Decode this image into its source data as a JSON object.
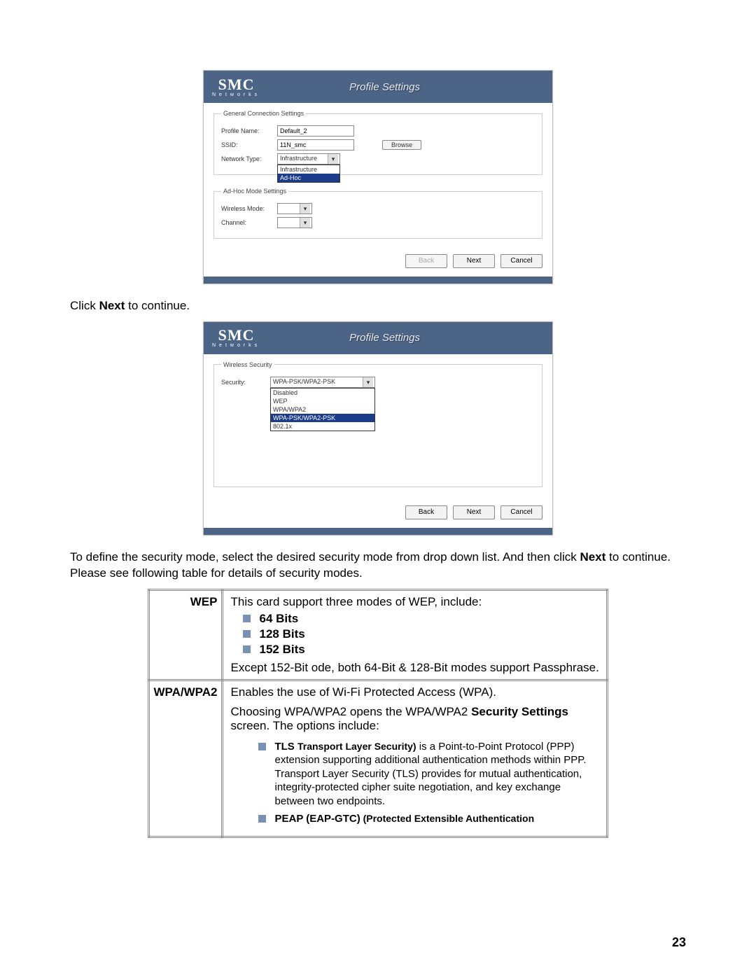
{
  "logo": {
    "main": "SMC",
    "sub": "Networks"
  },
  "dialog_title": "Profile Settings",
  "dialog1": {
    "legend_general": "General Connection Settings",
    "profile_label": "Profile Name:",
    "profile_value": "Default_2",
    "ssid_label": "SSID:",
    "ssid_value": "11N_smc",
    "browse": "Browse",
    "nettype_label": "Network Type:",
    "nettype_value": "Infrastructure",
    "nettype_options": [
      "Infrastructure",
      "Ad-Hoc"
    ],
    "legend_adhoc": "Ad-Hoc Mode Settings",
    "wmode_label": "Wireless Mode:",
    "channel_label": "Channel:",
    "buttons": {
      "back": "Back",
      "next": "Next",
      "cancel": "Cancel"
    }
  },
  "instruction1_pre": "Click ",
  "instruction1_bold": "Next",
  "instruction1_post": " to continue.",
  "dialog2": {
    "legend_sec": "Wireless Security",
    "sec_label": "Security:",
    "sec_value": "WPA-PSK/WPA2-PSK",
    "sec_options": [
      "Disabled",
      "WEP",
      "WPA/WPA2",
      "WPA-PSK/WPA2-PSK",
      "802.1x"
    ],
    "buttons": {
      "back": "Back",
      "next": "Next",
      "cancel": "Cancel"
    }
  },
  "instruction2_a": "To define the security mode, select the desired security mode from drop down list. And then click ",
  "instruction2_bold": "Next",
  "instruction2_b": " to continue. Please see following table for details of security modes.",
  "table": {
    "wep_head": "WEP",
    "wep_intro": "This card support three modes of WEP, include:",
    "wep_bits": [
      "64 Bits",
      "128 Bits",
      "152 Bits"
    ],
    "wep_note": "Except 152-Bit ode, both 64-Bit & 128-Bit modes support Passphrase.",
    "wpa_head": "WPA/WPA2",
    "wpa_l1": "Enables the use of Wi-Fi Protected Access (WPA).",
    "wpa_l2a": "Choosing WPA/WPA2 opens the WPA/WPA2 ",
    "wpa_l2b": "Security Settings",
    "wpa_l2c": " screen. The options include:",
    "tls_head": "TLS ",
    "tls_sub": "Transport Layer Security)",
    "tls_body": " is a Point-to-Point Protocol (PPP) extension supporting additional authentication methods within PPP. Transport Layer Security (TLS) provides for mutual authentication, integrity-protected cipher suite negotiation, and key exchange between two endpoints.",
    "peap_head": "PEAP (EAP-GTC)",
    "peap_sub": "  (Protected Extensible Authentication"
  },
  "page_number": "23"
}
